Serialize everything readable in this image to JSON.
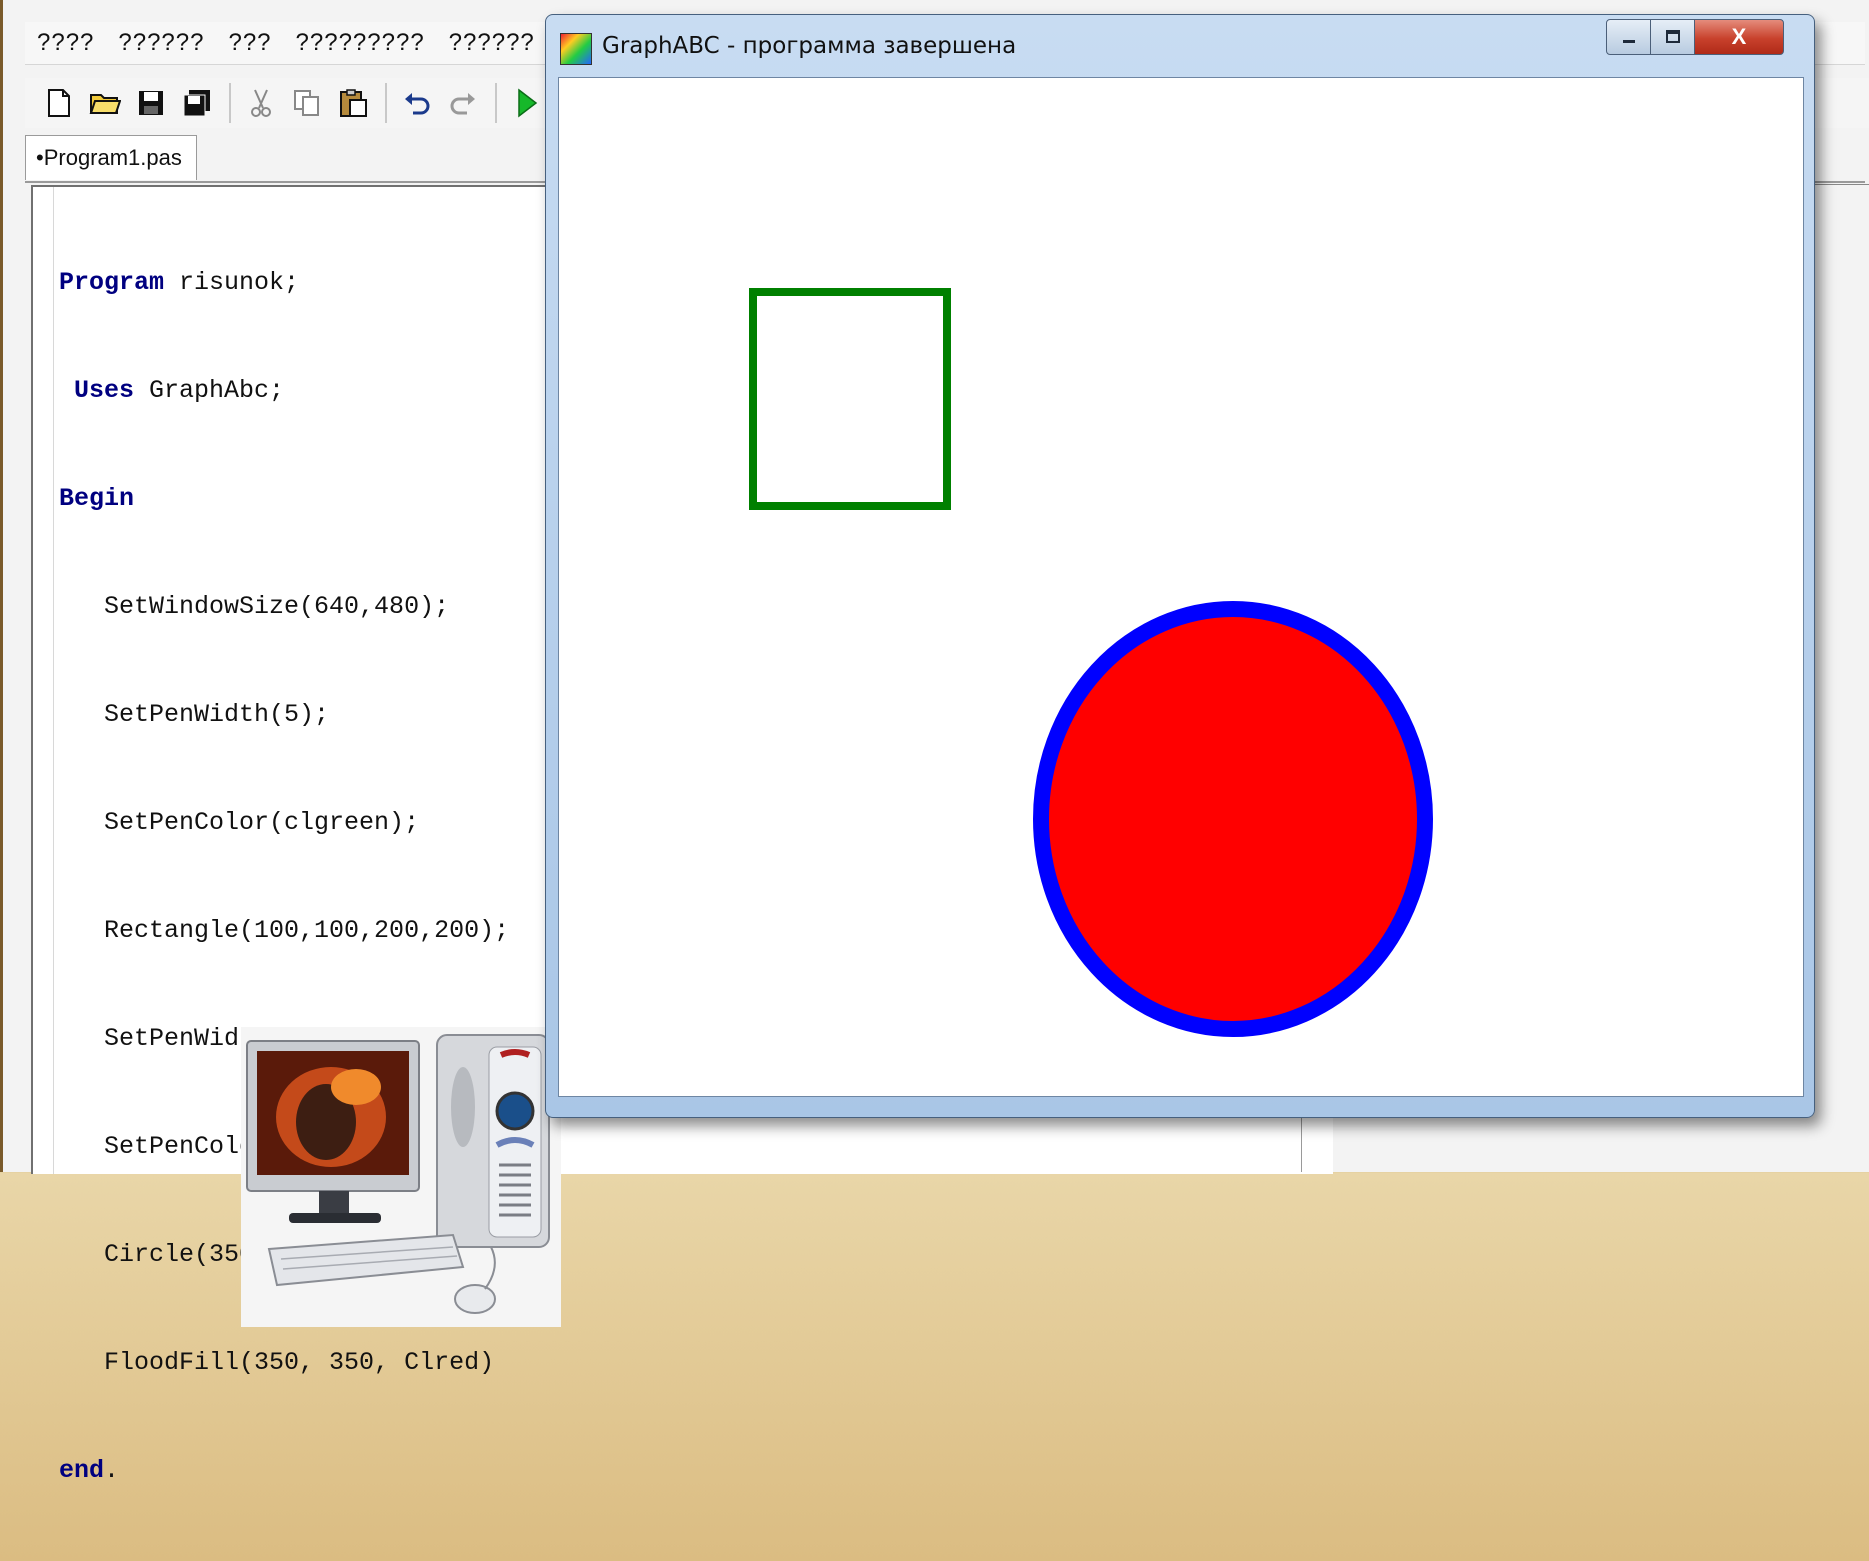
{
  "ide": {
    "menu": [
      "????",
      "??????",
      "???",
      "?????????",
      "??????",
      "?????"
    ],
    "toolbar": {
      "new_icon": "new-file-icon",
      "open_icon": "open-folder-icon",
      "save_icon": "save-icon",
      "saveall_icon": "save-all-icon",
      "cut_icon": "cut-icon",
      "copy_icon": "copy-icon",
      "paste_icon": "paste-icon",
      "undo_icon": "undo-icon",
      "redo_icon": "redo-icon",
      "run_icon": "run-icon"
    },
    "tab_label": "•Program1.pas",
    "code": [
      {
        "kw": "Program",
        "rest": " risunok;",
        "indent": ""
      },
      {
        "kw": "Uses",
        "rest": " GraphAbc;",
        "indent": " "
      },
      {
        "kw": "Begin",
        "rest": "",
        "indent": ""
      },
      {
        "kw": "",
        "rest": "SetWindowSize(640,480);",
        "indent": "   "
      },
      {
        "kw": "",
        "rest": "SetPenWidth(5);",
        "indent": "   "
      },
      {
        "kw": "",
        "rest": "SetPenColor(clgreen);",
        "indent": "   "
      },
      {
        "kw": "",
        "rest": "Rectangle(100,100,200,200);",
        "indent": "   "
      },
      {
        "kw": "",
        "rest": "SetPenWidth(9);",
        "indent": "   "
      },
      {
        "kw": "",
        "rest": "SetPenColor(clblue);",
        "indent": "   "
      },
      {
        "kw": "",
        "rest": "Circle(350, 350, 100);",
        "indent": "   "
      },
      {
        "kw": "",
        "rest": "FloodFill(350, 350, Clred)",
        "indent": "   "
      },
      {
        "kw": "end",
        "rest": ".",
        "indent": ""
      }
    ]
  },
  "graph_window": {
    "title": "GraphABC - программа завершена",
    "minimize_icon": "minimize-icon",
    "maximize_icon": "maximize-icon",
    "close_label": "X",
    "shapes": {
      "rectangle": {
        "pen_color": "#008000"
      },
      "circle": {
        "pen_color": "#0000ff",
        "fill_color": "#ff0000"
      }
    }
  }
}
